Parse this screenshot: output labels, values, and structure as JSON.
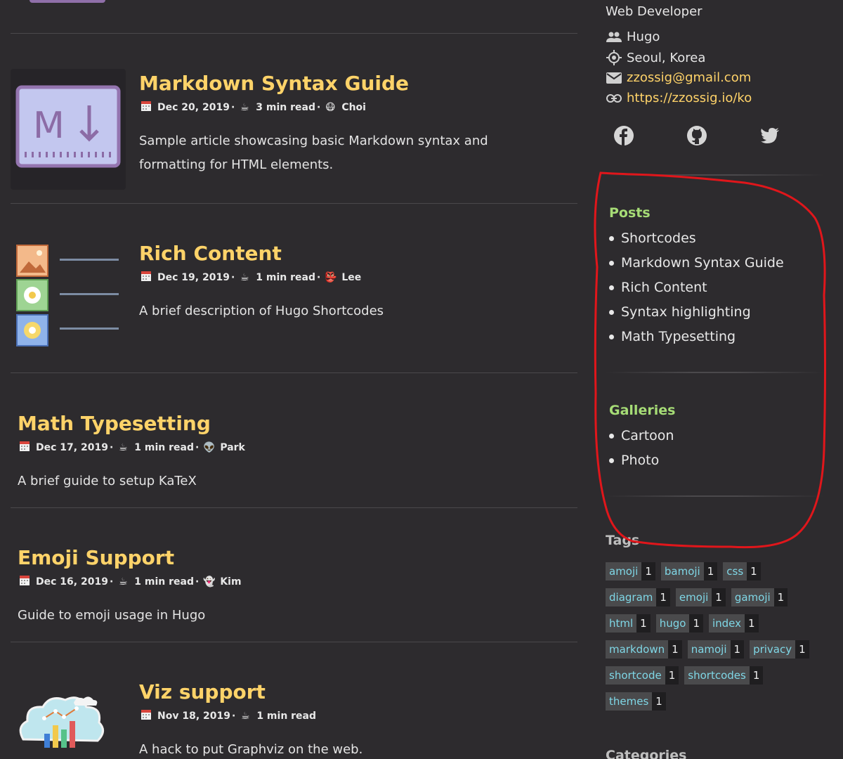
{
  "posts": [
    {
      "title": "Markdown Syntax Guide",
      "date": "Dec 20, 2019",
      "read": "3 min read",
      "author": "Choi",
      "summary": "Sample article showcasing basic Markdown syntax and formatting for HTML elements."
    },
    {
      "title": "Rich Content",
      "date": "Dec 19, 2019",
      "read": "1 min read",
      "author": "Lee",
      "summary": "A brief description of Hugo Shortcodes"
    },
    {
      "title": "Math Typesetting",
      "date": "Dec 17, 2019",
      "read": "1 min read",
      "author": "Park",
      "summary": "A brief guide to setup KaTeX"
    },
    {
      "title": "Emoji Support",
      "date": "Dec 16, 2019",
      "read": "1 min read",
      "author": "Kim",
      "summary": "Guide to emoji usage in Hugo"
    },
    {
      "title": "Viz support",
      "date": "Nov 18, 2019",
      "read": "1 min read",
      "summary": "A hack to put Graphviz on the web."
    }
  ],
  "profile": {
    "role": "Web Developer",
    "org": "Hugo",
    "location": "Seoul, Korea",
    "email": "zzossig@gmail.com",
    "website": "https://zzossig.io/ko"
  },
  "sidebar": {
    "posts_heading": "Posts",
    "posts": [
      "Shortcodes",
      "Markdown Syntax Guide",
      "Rich Content",
      "Syntax highlighting",
      "Math Typesetting"
    ],
    "galleries_heading": "Galleries",
    "galleries": [
      "Cartoon",
      "Photo"
    ],
    "tags_heading": "Tags",
    "tags": [
      [
        {
          "name": "amoji",
          "count": "1"
        },
        {
          "name": "bamoji",
          "count": "1"
        },
        {
          "name": "css",
          "count": "1"
        }
      ],
      [
        {
          "name": "diagram",
          "count": "1"
        },
        {
          "name": "emoji",
          "count": "1"
        },
        {
          "name": "gamoji",
          "count": "1"
        }
      ],
      [
        {
          "name": "html",
          "count": "1"
        },
        {
          "name": "hugo",
          "count": "1"
        },
        {
          "name": "index",
          "count": "1"
        }
      ],
      [
        {
          "name": "markdown",
          "count": "1"
        },
        {
          "name": "namoji",
          "count": "1"
        },
        {
          "name": "privacy",
          "count": "1"
        }
      ],
      [
        {
          "name": "shortcode",
          "count": "1"
        },
        {
          "name": "shortcodes",
          "count": "1"
        }
      ],
      [
        {
          "name": "themes",
          "count": "1"
        }
      ]
    ],
    "categories_heading": "Categories"
  },
  "icons": {
    "date": "calendar-icon",
    "read": "coffee-icon",
    "org": "people-icon",
    "location": "location-icon",
    "email": "mail-icon",
    "website": "link-icon",
    "social": [
      "facebook-icon",
      "github-icon",
      "twitter-icon"
    ]
  },
  "colors": {
    "background": "#2d2b2e",
    "title": "#ffd369",
    "section_heading": "#a6dc76",
    "tag_text": "#7fd7e6",
    "annotation": "#e0161b"
  }
}
